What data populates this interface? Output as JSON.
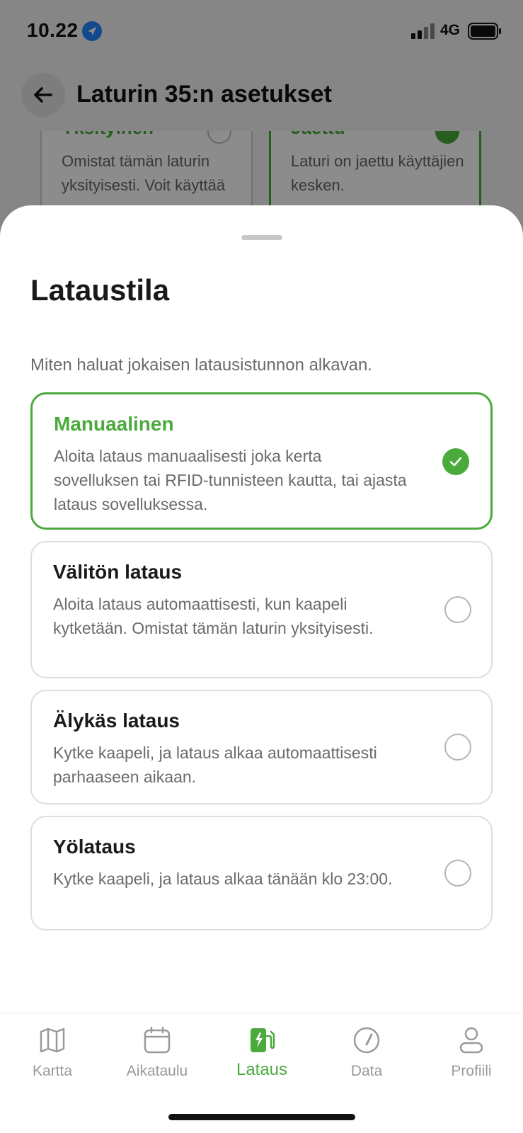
{
  "status_bar": {
    "time": "10.22",
    "network": "4G"
  },
  "header": {
    "title": "Laturin 35:n asetukset"
  },
  "background_cards": [
    {
      "title": "Yksityinen",
      "description": "Omistat tämän laturin yksityisesti. Voit käyttää",
      "selected": false
    },
    {
      "title": "Jaettu",
      "description": "Laturi on jaettu käyttäjien kesken.",
      "selected": true
    }
  ],
  "sheet": {
    "title": "Lataustila",
    "subtitle": "Miten haluat jokaisen latausistunnon alkavan.",
    "options": [
      {
        "title": "Manuaalinen",
        "description": "Aloita lataus manuaalisesti joka kerta sovelluksen tai RFID-tunnisteen kautta, tai ajasta lataus sovelluksessa.",
        "selected": true
      },
      {
        "title": "Välitön lataus",
        "description": "Aloita lataus automaattisesti, kun kaapeli kytketään. Omistat tämän laturin yksityisesti.",
        "selected": false
      },
      {
        "title": "Älykäs lataus",
        "description": "Kytke kaapeli, ja lataus alkaa automaattisesti parhaaseen aikaan.",
        "selected": false
      },
      {
        "title": "Yölataus",
        "description": "Kytke kaapeli, ja lataus alkaa tänään klo 23:00.",
        "selected": false
      }
    ]
  },
  "tabbar": {
    "tabs": [
      {
        "label": "Kartta",
        "icon": "map-icon",
        "active": false
      },
      {
        "label": "Aikataulu",
        "icon": "calendar-icon",
        "active": false
      },
      {
        "label": "Lataus",
        "icon": "charging-station-icon",
        "active": true
      },
      {
        "label": "Data",
        "icon": "gauge-icon",
        "active": false
      },
      {
        "label": "Profiili",
        "icon": "user-icon",
        "active": false
      }
    ]
  },
  "colors": {
    "accent": "#4aaa3c",
    "text_primary": "#1a1a1a",
    "text_secondary": "#6b6b6b"
  }
}
